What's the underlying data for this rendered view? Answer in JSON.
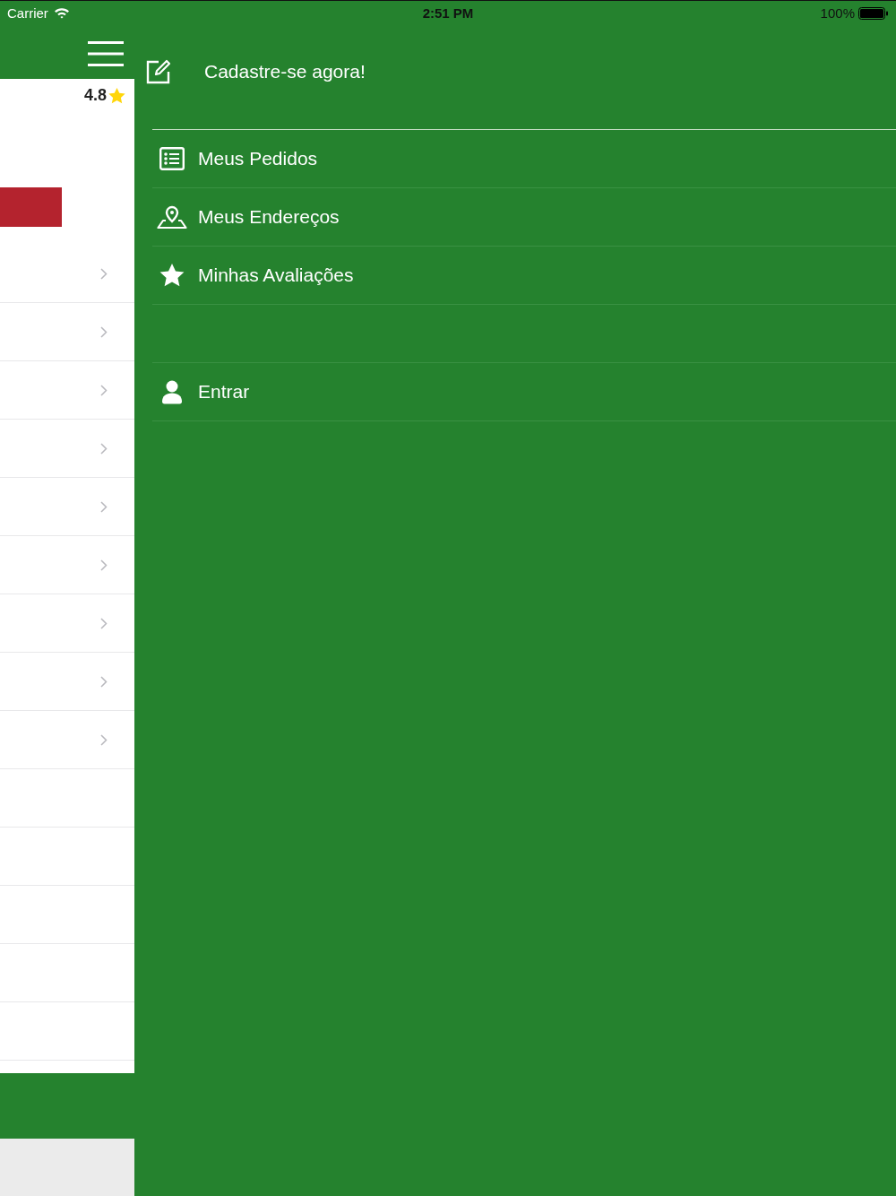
{
  "status_bar": {
    "carrier": "Carrier",
    "time": "2:51 PM",
    "battery": "100%"
  },
  "background_screen": {
    "rating": "4.8",
    "rows": [
      {
        "kind": "link"
      },
      {
        "kind": "link"
      },
      {
        "kind": "link"
      },
      {
        "kind": "link"
      },
      {
        "kind": "link"
      },
      {
        "kind": "link"
      },
      {
        "kind": "link"
      },
      {
        "kind": "link"
      },
      {
        "kind": "link"
      },
      {
        "kind": "blank"
      },
      {
        "kind": "blank"
      },
      {
        "kind": "blank"
      },
      {
        "kind": "blank"
      },
      {
        "kind": "blank"
      }
    ]
  },
  "side_menu": {
    "header": {
      "label": "Cadastre-se agora!"
    },
    "items": [
      {
        "kind": "item",
        "label": "Meus Pedidos"
      },
      {
        "kind": "item",
        "label": "Meus Endereços"
      },
      {
        "kind": "item",
        "label": "Minhas Avaliações"
      },
      {
        "kind": "spacer"
      },
      {
        "kind": "item",
        "label": "Entrar"
      }
    ]
  }
}
